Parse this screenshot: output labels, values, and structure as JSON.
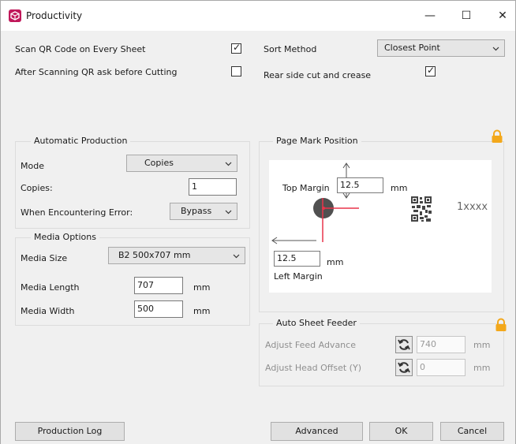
{
  "window": {
    "title": "Productivity",
    "minimize_glyph": "—",
    "maximize_glyph": "☐",
    "close_glyph": "✕"
  },
  "top_options": {
    "scan_qr_label": "Scan QR Code on Every Sheet",
    "scan_qr_checked": true,
    "ask_before_cutting_label": "After Scanning QR ask before Cutting",
    "ask_before_cutting_checked": false,
    "sort_method_label": "Sort Method",
    "sort_method_value": "Closest Point",
    "rear_side_label": "Rear side cut and crease",
    "rear_side_checked": true
  },
  "automatic_production": {
    "title": "Automatic Production",
    "mode_label": "Mode",
    "mode_value": "Copies",
    "copies_label": "Copies:",
    "copies_value": "1",
    "error_label": "When Encountering Error:",
    "error_value": "Bypass"
  },
  "media_options": {
    "title": "Media Options",
    "size_label": "Media Size",
    "size_value": "B2 500x707 mm",
    "length_label": "Media Length",
    "length_value": "707",
    "length_unit": "mm",
    "width_label": "Media Width",
    "width_value": "500",
    "width_unit": "mm"
  },
  "page_mark": {
    "title": "Page Mark Position",
    "top_margin_label": "Top Margin",
    "top_margin_value": "12.5",
    "top_unit": "mm",
    "left_margin_value": "12.5",
    "left_unit": "mm",
    "left_margin_label": "Left Margin",
    "qr_caption": "1xxxx"
  },
  "auto_sheet_feeder": {
    "title": "Auto Sheet Feeder",
    "feed_label": "Adjust Feed Advance",
    "feed_value": "740",
    "feed_unit": "mm",
    "head_label": "Adjust Head Offset (Y)",
    "head_value": "0",
    "head_unit": "mm"
  },
  "footer": {
    "production_log": "Production Log",
    "advanced": "Advanced",
    "ok": "OK",
    "cancel": "Cancel"
  },
  "colors": {
    "accent_red": "#e8344a",
    "lock": "#f3a81b",
    "icon": "#c0185a"
  }
}
